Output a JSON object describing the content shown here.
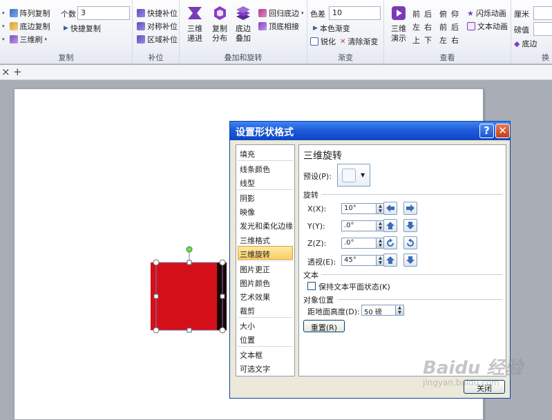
{
  "ribbon": {
    "copy_group": {
      "label": "复制",
      "array_copy": "阵列复制",
      "bottom_copy": "底边复制",
      "brush_3d": "三维刷",
      "count_label": "个数",
      "count_value": "3",
      "quick_copy": "快捷复制"
    },
    "fill_group": {
      "label": "补位",
      "quick_fill": "快捷补位",
      "sym_fill": "对称补位",
      "area_fill": "区域补位"
    },
    "stack_group": {
      "label": "叠加和旋转",
      "step_3d": "三维\n递进",
      "copy_dist": "复制\n分布",
      "bottom_stack": "底边\n叠加",
      "return_bottom": "回归底边",
      "top_bottom": "顶底相接"
    },
    "gradient_group": {
      "label": "渐变",
      "color_diff_label": "色差",
      "color_diff_value": "10",
      "own_color_grad": "本色渐变",
      "sharpen": "锐化",
      "clear_grad": "清除渐变"
    },
    "view_group": {
      "label": "查看",
      "demo_3d": "三维\n演示",
      "front": "前",
      "back": "后",
      "top": "俯",
      "bottom": "仰",
      "left1": "左",
      "right1": "右",
      "left2": "左",
      "right2": "右",
      "up": "上",
      "down": "下",
      "front2": "前",
      "back2": "后",
      "flash_anim": "闪烁动画",
      "text_anim": "文本动画"
    },
    "extra_group": {
      "cm": "厘米",
      "pound": "磅值",
      "bottom_edge": "底边",
      "swap": "换"
    }
  },
  "tabs": {
    "close": "×",
    "add": "+"
  },
  "dialog": {
    "title": "设置形状格式",
    "help": "?",
    "close_x": "✕",
    "nav": [
      "填充",
      "线条颜色",
      "线型",
      "阴影",
      "映像",
      "发光和柔化边缘",
      "三维格式",
      "三维旋转",
      "图片更正",
      "图片颜色",
      "艺术效果",
      "裁剪",
      "大小",
      "位置",
      "文本框",
      "可选文字"
    ],
    "selected_nav": "三维旋转",
    "panel": {
      "heading": "三维旋转",
      "preset_label": "预设(P):",
      "rotation_label": "旋转",
      "x_label": "X(X):",
      "x_value": "10°",
      "y_label": "Y(Y):",
      "y_value": ".0°",
      "z_label": "Z(Z):",
      "z_value": ".0°",
      "perspective_label": "透视(E):",
      "perspective_value": "45°",
      "text_label": "文本",
      "keep_text_flat": "保持文本平面状态(K)",
      "object_pos_label": "对象位置",
      "distance_label": "距地面高度(D):",
      "distance_value": "50 磅",
      "reset": "重置(R)"
    },
    "close_button": "关闭"
  },
  "watermark": {
    "text": "Baidu 经验",
    "sub": "jingyan.baidu.com"
  },
  "colors": {
    "shape_red": "#d3101a",
    "title_blue": "#1f5bd8",
    "selected_nav": "#f9cf62"
  }
}
